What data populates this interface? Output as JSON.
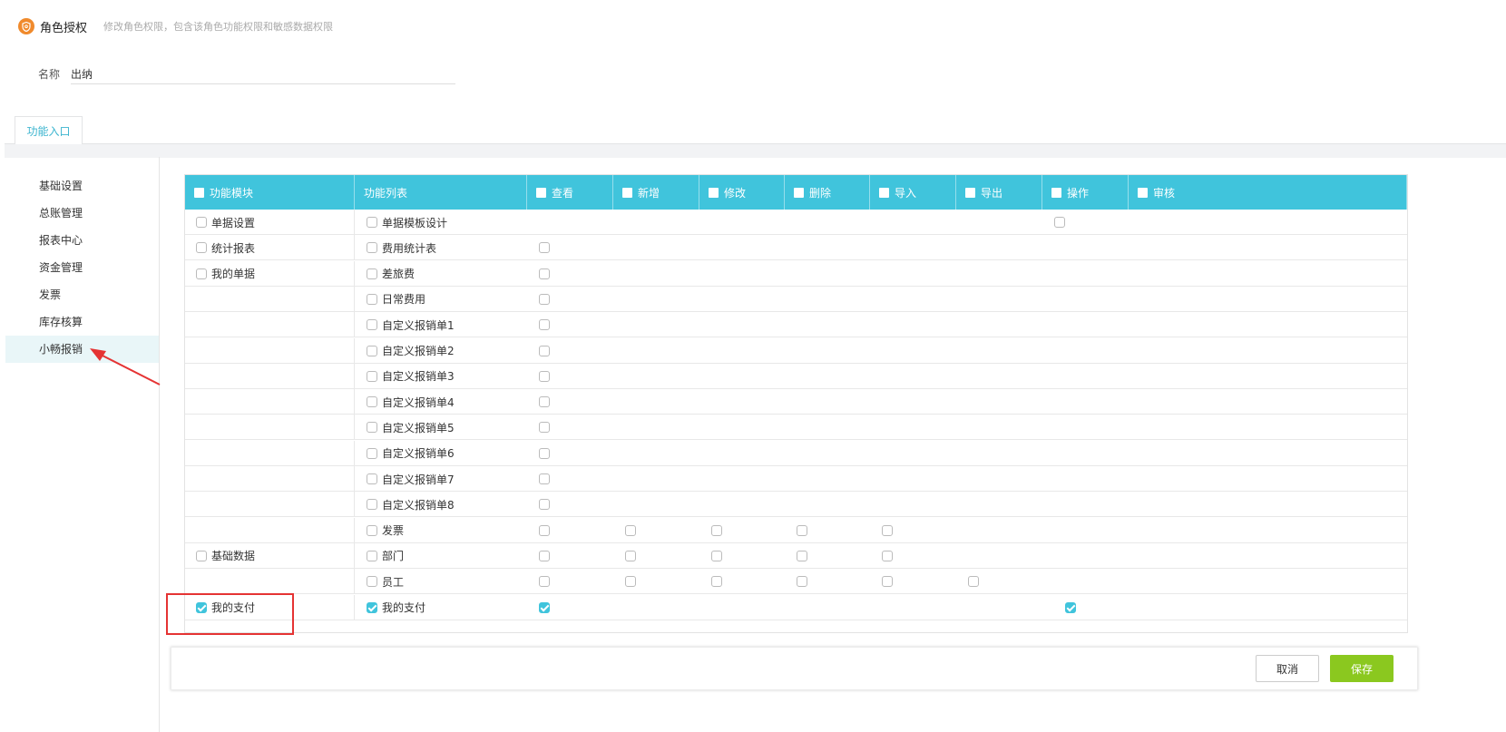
{
  "header": {
    "title": "角色授权",
    "subtitle": "修改角色权限，包含该角色功能权限和敏感数据权限",
    "logo_icon": "shield-icon",
    "logo_color": "#f08a2c"
  },
  "name_field": {
    "label": "名称",
    "value": "出纳"
  },
  "tabs": [
    {
      "label": "功能入口",
      "active": true
    }
  ],
  "sidebar": {
    "items": [
      {
        "label": "基础设置"
      },
      {
        "label": "总账管理"
      },
      {
        "label": "报表中心"
      },
      {
        "label": "资金管理"
      },
      {
        "label": "发票"
      },
      {
        "label": "库存核算"
      },
      {
        "label": "小畅报销",
        "active": true
      }
    ]
  },
  "table": {
    "header_color": "#40c4dc",
    "columns": [
      {
        "label": "功能模块",
        "checkbox": true
      },
      {
        "label": "功能列表",
        "checkbox": false
      },
      {
        "label": "查看",
        "checkbox": true
      },
      {
        "label": "新增",
        "checkbox": true
      },
      {
        "label": "修改",
        "checkbox": true
      },
      {
        "label": "删除",
        "checkbox": true
      },
      {
        "label": "导入",
        "checkbox": true
      },
      {
        "label": "导出",
        "checkbox": true
      },
      {
        "label": "操作",
        "checkbox": true
      },
      {
        "label": "审核",
        "checkbox": true
      }
    ],
    "rows": [
      {
        "module": "单据设置",
        "function": "单据模板设计",
        "perms": [
          "",
          "",
          "",
          "",
          "",
          "",
          "unchecked",
          ""
        ]
      },
      {
        "module": "统计报表",
        "function": "费用统计表",
        "perms": [
          "unchecked",
          "",
          "",
          "",
          "",
          "",
          "",
          ""
        ]
      },
      {
        "module": "我的单据",
        "function": "差旅费",
        "perms": [
          "unchecked",
          "",
          "",
          "",
          "",
          "",
          "",
          ""
        ]
      },
      {
        "module": "",
        "function": "日常费用",
        "perms": [
          "unchecked",
          "",
          "",
          "",
          "",
          "",
          "",
          ""
        ]
      },
      {
        "module": "",
        "function": "自定义报销单1",
        "perms": [
          "unchecked",
          "",
          "",
          "",
          "",
          "",
          "",
          ""
        ]
      },
      {
        "module": "",
        "function": "自定义报销单2",
        "perms": [
          "unchecked",
          "",
          "",
          "",
          "",
          "",
          "",
          ""
        ]
      },
      {
        "module": "",
        "function": "自定义报销单3",
        "perms": [
          "unchecked",
          "",
          "",
          "",
          "",
          "",
          "",
          ""
        ]
      },
      {
        "module": "",
        "function": "自定义报销单4",
        "perms": [
          "unchecked",
          "",
          "",
          "",
          "",
          "",
          "",
          ""
        ]
      },
      {
        "module": "",
        "function": "自定义报销单5",
        "perms": [
          "unchecked",
          "",
          "",
          "",
          "",
          "",
          "",
          ""
        ]
      },
      {
        "module": "",
        "function": "自定义报销单6",
        "perms": [
          "unchecked",
          "",
          "",
          "",
          "",
          "",
          "",
          ""
        ]
      },
      {
        "module": "",
        "function": "自定义报销单7",
        "perms": [
          "unchecked",
          "",
          "",
          "",
          "",
          "",
          "",
          ""
        ]
      },
      {
        "module": "",
        "function": "自定义报销单8",
        "perms": [
          "unchecked",
          "",
          "",
          "",
          "",
          "",
          "",
          ""
        ]
      },
      {
        "module": "",
        "function": "发票",
        "perms": [
          "unchecked",
          "unchecked",
          "unchecked",
          "unchecked",
          "unchecked",
          "",
          "",
          ""
        ]
      },
      {
        "module": "基础数据",
        "function": "部门",
        "perms": [
          "unchecked",
          "unchecked",
          "unchecked",
          "unchecked",
          "unchecked",
          "",
          "",
          ""
        ]
      },
      {
        "module": "",
        "function": "员工",
        "perms": [
          "unchecked",
          "unchecked",
          "unchecked",
          "unchecked",
          "unchecked",
          "unchecked",
          "",
          ""
        ]
      },
      {
        "module": "我的支付",
        "module_checked": true,
        "function": "我的支付",
        "function_checked": true,
        "perms": [
          "checked",
          "",
          "",
          "",
          "",
          "",
          "checked",
          ""
        ]
      }
    ]
  },
  "footer": {
    "cancel_label": "取消",
    "save_label": "保存",
    "save_color": "#8bc81f"
  },
  "annotation": {
    "color": "#e53333"
  }
}
